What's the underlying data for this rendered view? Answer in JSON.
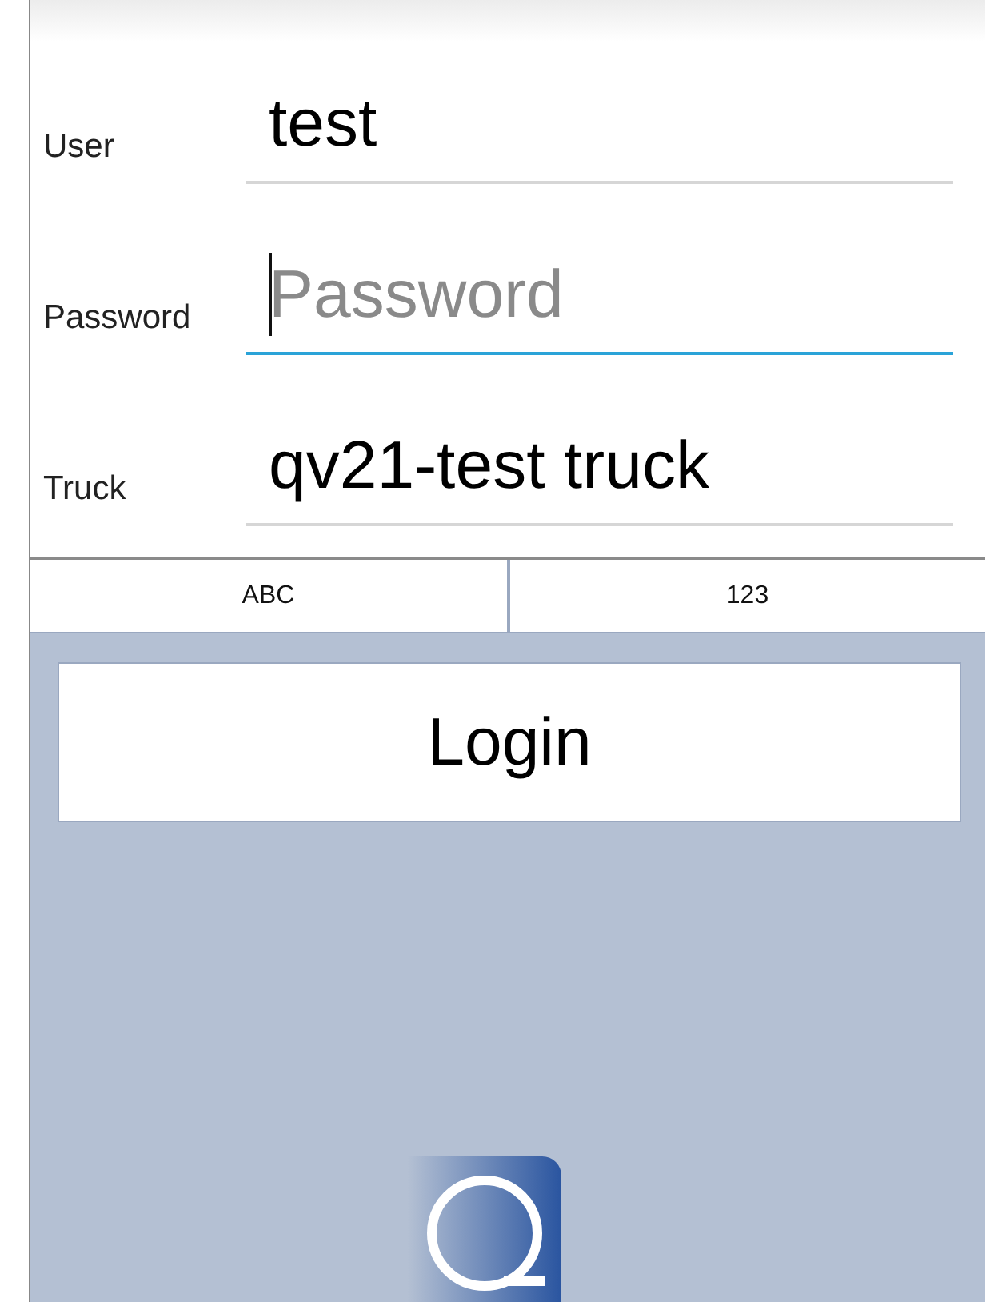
{
  "fields": [
    {
      "label": "User",
      "value": "test",
      "focused": false
    },
    {
      "label": "Password",
      "placeholder": "Password",
      "focused": true
    },
    {
      "label": "Truck",
      "value": "qv21-test truck",
      "focused": false
    }
  ],
  "keyboard_tabs": [
    {
      "label": "ABC"
    },
    {
      "label": "123"
    }
  ],
  "login_button": {
    "label": "Login"
  }
}
